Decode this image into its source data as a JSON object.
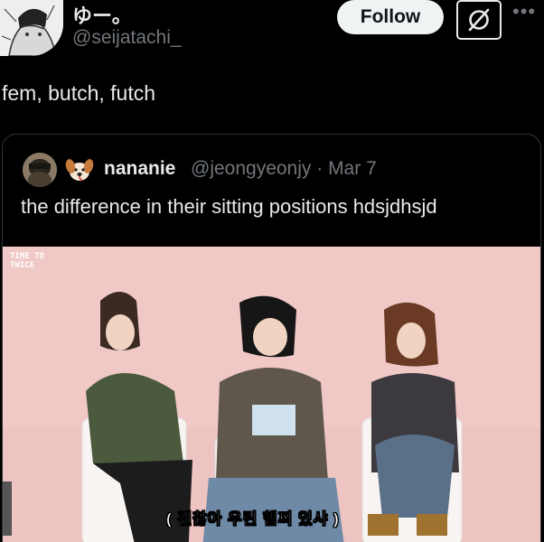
{
  "author": {
    "display_name": "ゆー。",
    "handle": "@seijatachi_",
    "avatar_icon": "avatar-illustration"
  },
  "actions": {
    "follow_label": "Follow",
    "grok_icon": "grok-icon",
    "more_icon": "more-icon"
  },
  "tweet": {
    "text": "fem, butch, futch"
  },
  "quoted": {
    "display_name": "nananie",
    "handle_date": "@jeongyeonjy · Mar 7",
    "text": "the difference in their sitting positions hdsjdhsjd",
    "avatar_icon": "avatar-photo",
    "emoji_icon": "dog-face-emoji"
  },
  "media": {
    "watermark": "TIME TO TWICE",
    "subtitle": "( 괜찮아 우린 햄찌 있샤 )"
  },
  "colors": {
    "background": "#000000",
    "text": "#e7e9ea",
    "muted": "#71767b",
    "border": "#2f3336",
    "media_bg": "#f0c9c7"
  }
}
